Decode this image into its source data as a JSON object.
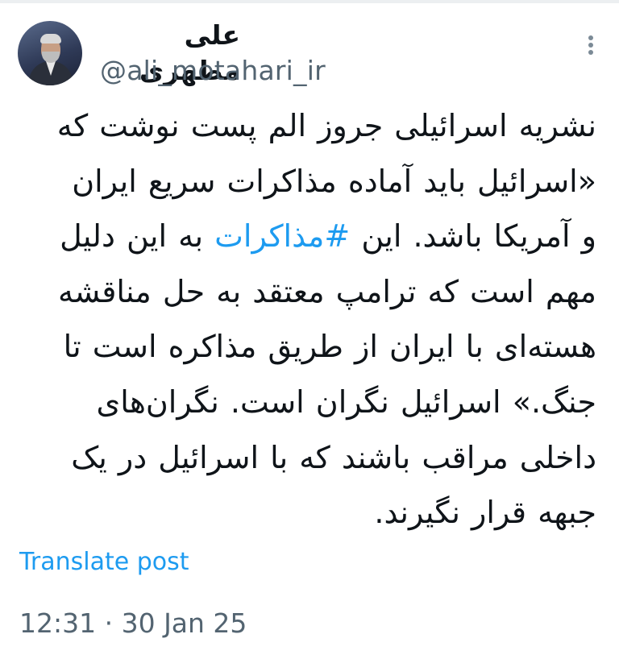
{
  "author": {
    "display_name": "علی مطهری",
    "handle": "@ali_motahari_ir"
  },
  "tweet": {
    "lines": [
      [
        "نشریه اسرائیلی جروز الم پست نوشت که"
      ],
      [
        "«اسرائیل باید آماده مذاکرات سریع ایران"
      ],
      [
        "و آمریکا باشد. این ",
        "#مذاکرات",
        " به این دلیل"
      ],
      [
        "مهم است که ترامپ معتقد به حل مناقشه"
      ],
      [
        "هسته‌ای با ایران از طریق مذاکره است تا"
      ],
      [
        "جنگ.» اسرائیل نگران است. نگران‌های"
      ],
      [
        "داخلی مراقب باشند که با اسرائیل در یک"
      ],
      [
        "جبهه قرار نگیرند."
      ]
    ],
    "hashtag": "#مذاکرات"
  },
  "actions": {
    "translate_label": "Translate post"
  },
  "meta": {
    "time": "12:31",
    "separator": " · ",
    "date": "30 Jan 25"
  },
  "icons": {
    "more": "more-options-icon"
  },
  "colors": {
    "link": "#1d9bf0",
    "secondary_text": "#536471",
    "primary_text": "#0f1419"
  }
}
